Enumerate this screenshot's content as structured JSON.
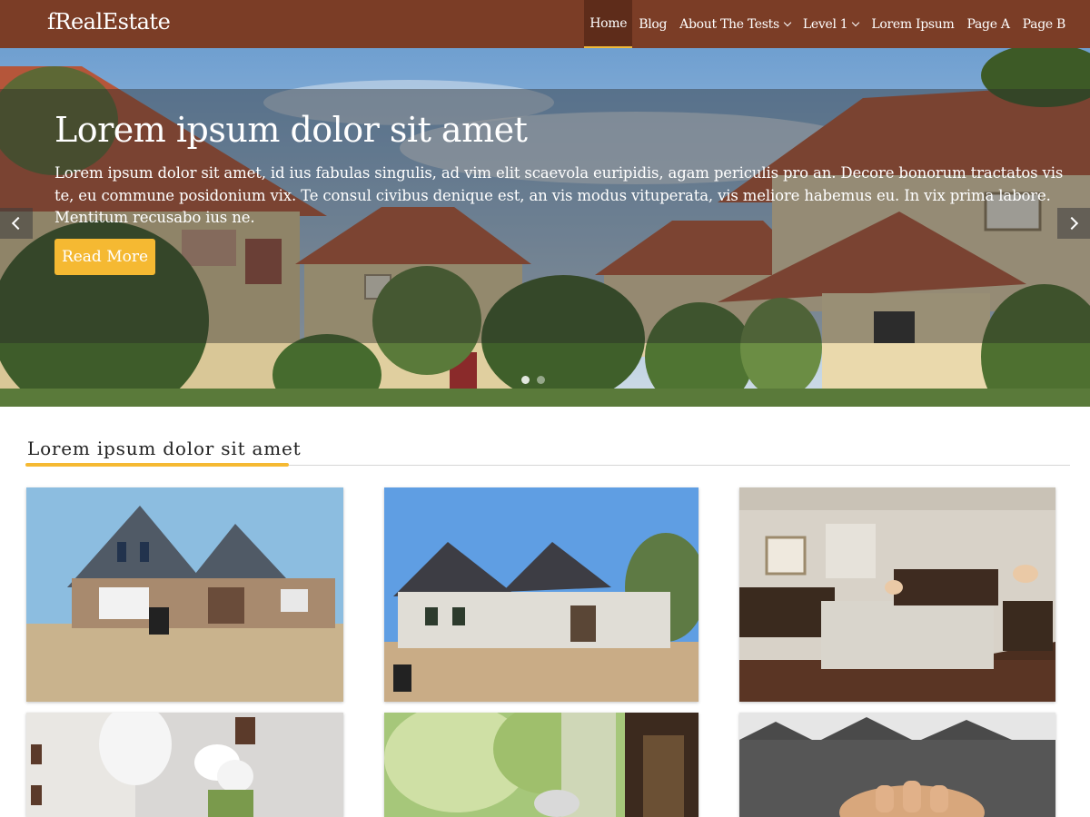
{
  "site": {
    "title": "fRealEstate"
  },
  "nav": {
    "items": [
      {
        "label": "Home",
        "active": true,
        "dropdown": false
      },
      {
        "label": "Blog",
        "active": false,
        "dropdown": false
      },
      {
        "label": "About The Tests",
        "active": false,
        "dropdown": true
      },
      {
        "label": "Level 1",
        "active": false,
        "dropdown": true
      },
      {
        "label": "Lorem Ipsum",
        "active": false,
        "dropdown": false
      },
      {
        "label": "Page A",
        "active": false,
        "dropdown": false
      },
      {
        "label": "Page B",
        "active": false,
        "dropdown": false
      }
    ]
  },
  "hero": {
    "title": "Lorem ipsum dolor sit amet",
    "text": "Lorem ipsum dolor sit amet, id ius fabulas singulis, ad vim elit scaevola euripidis, agam periculis pro an. Decore bonorum tractatos vis te, eu commune posidonium vix. Te consul civibus denique est, an vis modus vituperata, vis meliore habemus eu. In vix prima labore. Mentitum recusabo ius ne.",
    "button_label": "Read More",
    "prev_icon": "chevron-left-icon",
    "next_icon": "chevron-right-icon",
    "slides": 2,
    "active_slide": 1
  },
  "section": {
    "title": "Lorem ipsum dolor sit amet"
  },
  "colors": {
    "header": "#7b3d26",
    "accent": "#f5b932"
  }
}
